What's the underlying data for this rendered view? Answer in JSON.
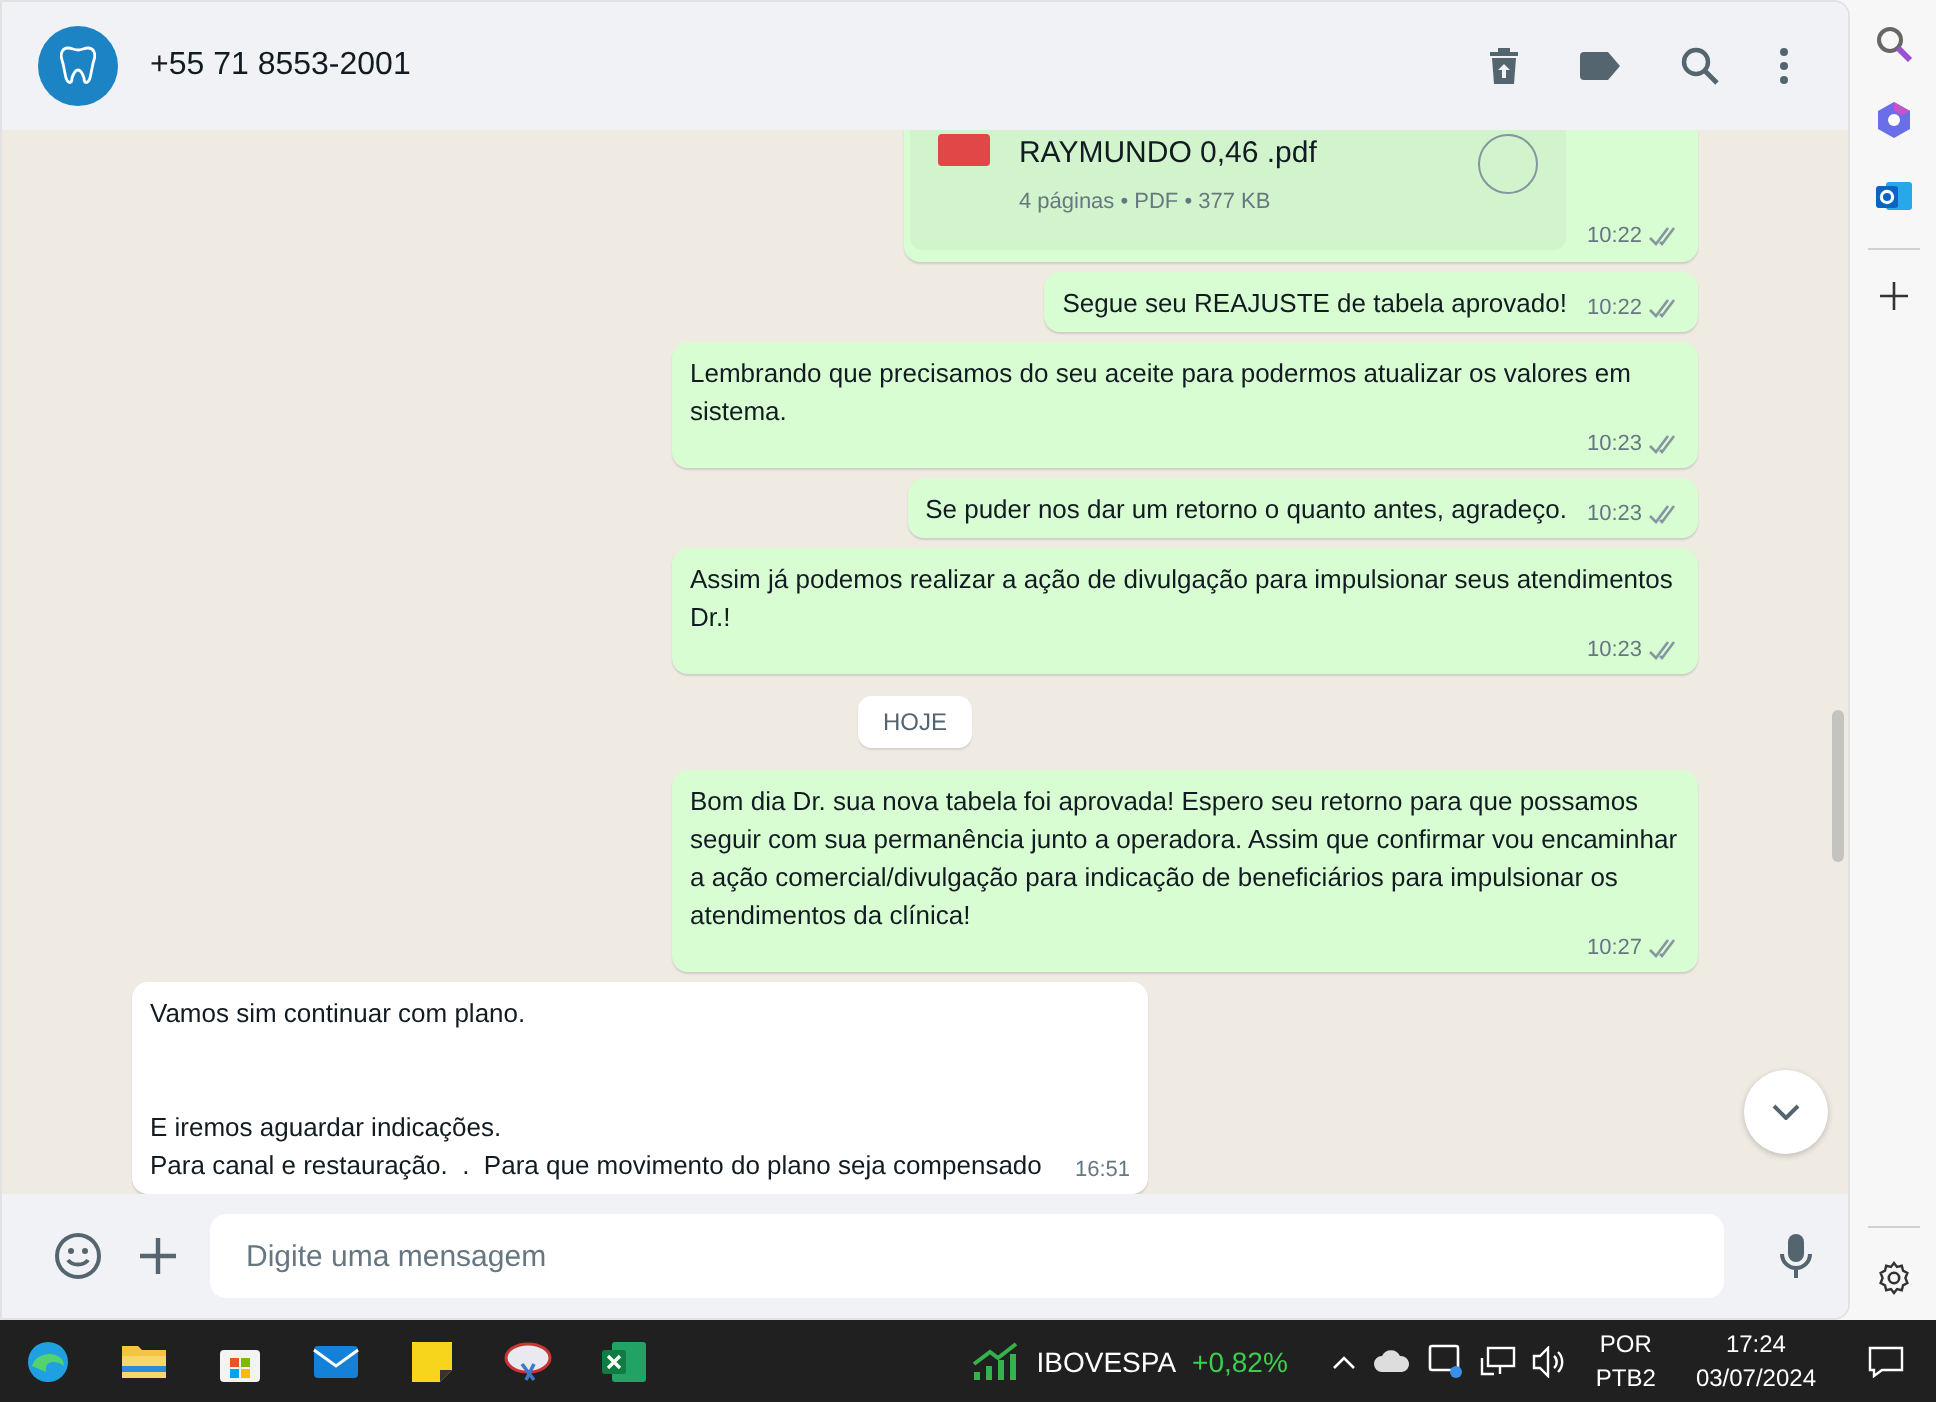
{
  "chat_header": {
    "contact": "+55 71 8553-2001"
  },
  "messages": [
    {
      "kind": "document",
      "outgoing": true,
      "file_name": "RAYMUNDO 0,46 .pdf",
      "file_meta": "4 páginas • PDF • 377 KB",
      "time": "10:22",
      "read": false
    },
    {
      "kind": "text",
      "outgoing": true,
      "text": "Segue seu REAJUSTE de tabela aprovado!",
      "time": "10:22",
      "read": false
    },
    {
      "kind": "text",
      "outgoing": true,
      "text": "Lembrando que precisamos do seu aceite para podermos atualizar os valores em sistema.",
      "time": "10:23",
      "read": false
    },
    {
      "kind": "text",
      "outgoing": true,
      "text": "Se puder nos dar um retorno o quanto antes, agradeço.",
      "time": "10:23",
      "read": false
    },
    {
      "kind": "text",
      "outgoing": true,
      "text": "Assim já podemos realizar a ação de divulgação para impulsionar seus atendimentos Dr.!",
      "time": "10:23",
      "read": false
    },
    {
      "kind": "day",
      "text": "HOJE"
    },
    {
      "kind": "text",
      "outgoing": true,
      "text": "Bom dia Dr. sua nova tabela foi aprovada! Espero seu retorno para que possamos seguir com sua permanência junto a operadora. Assim que confirmar vou encaminhar a ação comercial/divulgação para indicação de beneficiários para impulsionar os atendimentos da clínica!",
      "time": "10:27",
      "read": false
    },
    {
      "kind": "text",
      "outgoing": false,
      "text": "Vamos sim continuar com plano.\n\n\nE iremos aguardar indicações.\nPara canal e restauração.  .  Para que movimento do plano seja compensado",
      "time": "16:51"
    }
  ],
  "composer": {
    "placeholder": "Digite uma mensagem"
  },
  "taskbar": {
    "ticker_name": "IBOVESPA",
    "ticker_change": "+0,82%",
    "language": "POR",
    "layout": "PTB2",
    "time": "17:24",
    "date": "03/07/2024"
  }
}
